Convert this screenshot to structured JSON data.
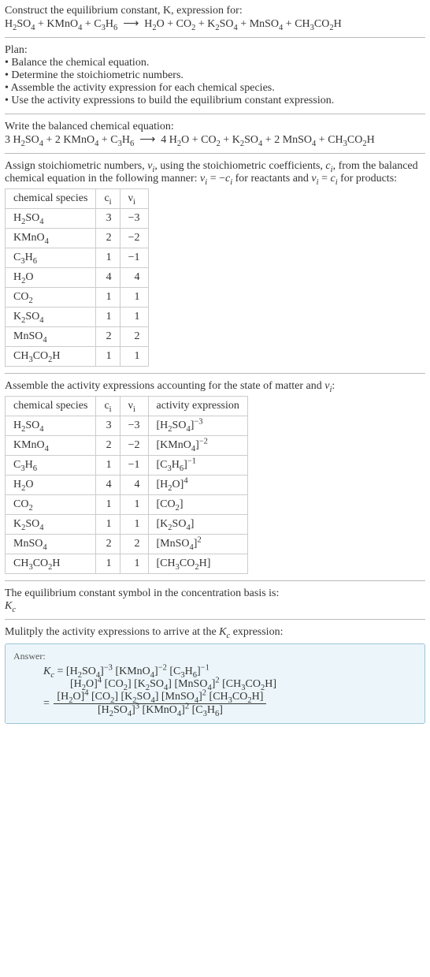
{
  "intro": {
    "line1": "Construct the equilibrium constant, K, expression for:",
    "equation": "H<sub>2</sub>SO<sub>4</sub> + KMnO<sub>4</sub> + C<sub>3</sub>H<sub>6</sub> &nbsp;⟶&nbsp; H<sub>2</sub>O + CO<sub>2</sub> + K<sub>2</sub>SO<sub>4</sub> + MnSO<sub>4</sub> + CH<sub>3</sub>CO<sub>2</sub>H"
  },
  "plan": {
    "heading": "Plan:",
    "items": [
      "• Balance the chemical equation.",
      "• Determine the stoichiometric numbers.",
      "• Assemble the activity expression for each chemical species.",
      "• Use the activity expressions to build the equilibrium constant expression."
    ]
  },
  "balanced": {
    "heading": "Write the balanced chemical equation:",
    "equation": "3 H<sub>2</sub>SO<sub>4</sub> + 2 KMnO<sub>4</sub> + C<sub>3</sub>H<sub>6</sub> &nbsp;⟶&nbsp; 4 H<sub>2</sub>O + CO<sub>2</sub> + K<sub>2</sub>SO<sub>4</sub> + 2 MnSO<sub>4</sub> + CH<sub>3</sub>CO<sub>2</sub>H"
  },
  "stoich": {
    "heading_html": "Assign stoichiometric numbers, <span class='ital'>ν<sub>i</sub></span>, using the stoichiometric coefficients, <span class='ital'>c<sub>i</sub></span>, from the balanced chemical equation in the following manner: <span class='ital'>ν<sub>i</sub></span> = −<span class='ital'>c<sub>i</sub></span> for reactants and <span class='ital'>ν<sub>i</sub></span> = <span class='ital'>c<sub>i</sub></span> for products:",
    "headers": [
      "chemical species",
      "c<sub>i</sub>",
      "ν<sub>i</sub>"
    ],
    "rows": [
      {
        "species": "H<sub>2</sub>SO<sub>4</sub>",
        "c": "3",
        "v": "−3"
      },
      {
        "species": "KMnO<sub>4</sub>",
        "c": "2",
        "v": "−2"
      },
      {
        "species": "C<sub>3</sub>H<sub>6</sub>",
        "c": "1",
        "v": "−1"
      },
      {
        "species": "H<sub>2</sub>O",
        "c": "4",
        "v": "4"
      },
      {
        "species": "CO<sub>2</sub>",
        "c": "1",
        "v": "1"
      },
      {
        "species": "K<sub>2</sub>SO<sub>4</sub>",
        "c": "1",
        "v": "1"
      },
      {
        "species": "MnSO<sub>4</sub>",
        "c": "2",
        "v": "2"
      },
      {
        "species": "CH<sub>3</sub>CO<sub>2</sub>H",
        "c": "1",
        "v": "1"
      }
    ]
  },
  "activity": {
    "heading_html": "Assemble the activity expressions accounting for the state of matter and <span class='ital'>ν<sub>i</sub></span>:",
    "headers": [
      "chemical species",
      "c<sub>i</sub>",
      "ν<sub>i</sub>",
      "activity expression"
    ],
    "rows": [
      {
        "species": "H<sub>2</sub>SO<sub>4</sub>",
        "c": "3",
        "v": "−3",
        "a": "[H<sub>2</sub>SO<sub>4</sub>]<sup>−3</sup>"
      },
      {
        "species": "KMnO<sub>4</sub>",
        "c": "2",
        "v": "−2",
        "a": "[KMnO<sub>4</sub>]<sup>−2</sup>"
      },
      {
        "species": "C<sub>3</sub>H<sub>6</sub>",
        "c": "1",
        "v": "−1",
        "a": "[C<sub>3</sub>H<sub>6</sub>]<sup>−1</sup>"
      },
      {
        "species": "H<sub>2</sub>O",
        "c": "4",
        "v": "4",
        "a": "[H<sub>2</sub>O]<sup>4</sup>"
      },
      {
        "species": "CO<sub>2</sub>",
        "c": "1",
        "v": "1",
        "a": "[CO<sub>2</sub>]"
      },
      {
        "species": "K<sub>2</sub>SO<sub>4</sub>",
        "c": "1",
        "v": "1",
        "a": "[K<sub>2</sub>SO<sub>4</sub>]"
      },
      {
        "species": "MnSO<sub>4</sub>",
        "c": "2",
        "v": "2",
        "a": "[MnSO<sub>4</sub>]<sup>2</sup>"
      },
      {
        "species": "CH<sub>3</sub>CO<sub>2</sub>H",
        "c": "1",
        "v": "1",
        "a": "[CH<sub>3</sub>CO<sub>2</sub>H]"
      }
    ]
  },
  "kc_symbol": {
    "heading": "The equilibrium constant symbol in the concentration basis is:",
    "symbol": "K<sub>c</sub>"
  },
  "multiply": {
    "heading_html": "Mulitply the activity expressions to arrive at the <span class='ital'>K<sub>c</sub></span> expression:"
  },
  "answer": {
    "label": "Answer:",
    "line1": "<span class='ital'>K<sub>c</sub></span> = [H<sub>2</sub>SO<sub>4</sub>]<sup>−3</sup> [KMnO<sub>4</sub>]<sup>−2</sup> [C<sub>3</sub>H<sub>6</sub>]<sup>−1</sup>",
    "line2": "[H<sub>2</sub>O]<sup>4</sup> [CO<sub>2</sub>] [K<sub>2</sub>SO<sub>4</sub>] [MnSO<sub>4</sub>]<sup>2</sup> [CH<sub>3</sub>CO<sub>2</sub>H]",
    "frac_num": "[H<sub>2</sub>O]<sup>4</sup> [CO<sub>2</sub>] [K<sub>2</sub>SO<sub>4</sub>] [MnSO<sub>4</sub>]<sup>2</sup> [CH<sub>3</sub>CO<sub>2</sub>H]",
    "frac_den": "[H<sub>2</sub>SO<sub>4</sub>]<sup>3</sup> [KMnO<sub>4</sub>]<sup>2</sup> [C<sub>3</sub>H<sub>6</sub>]"
  }
}
